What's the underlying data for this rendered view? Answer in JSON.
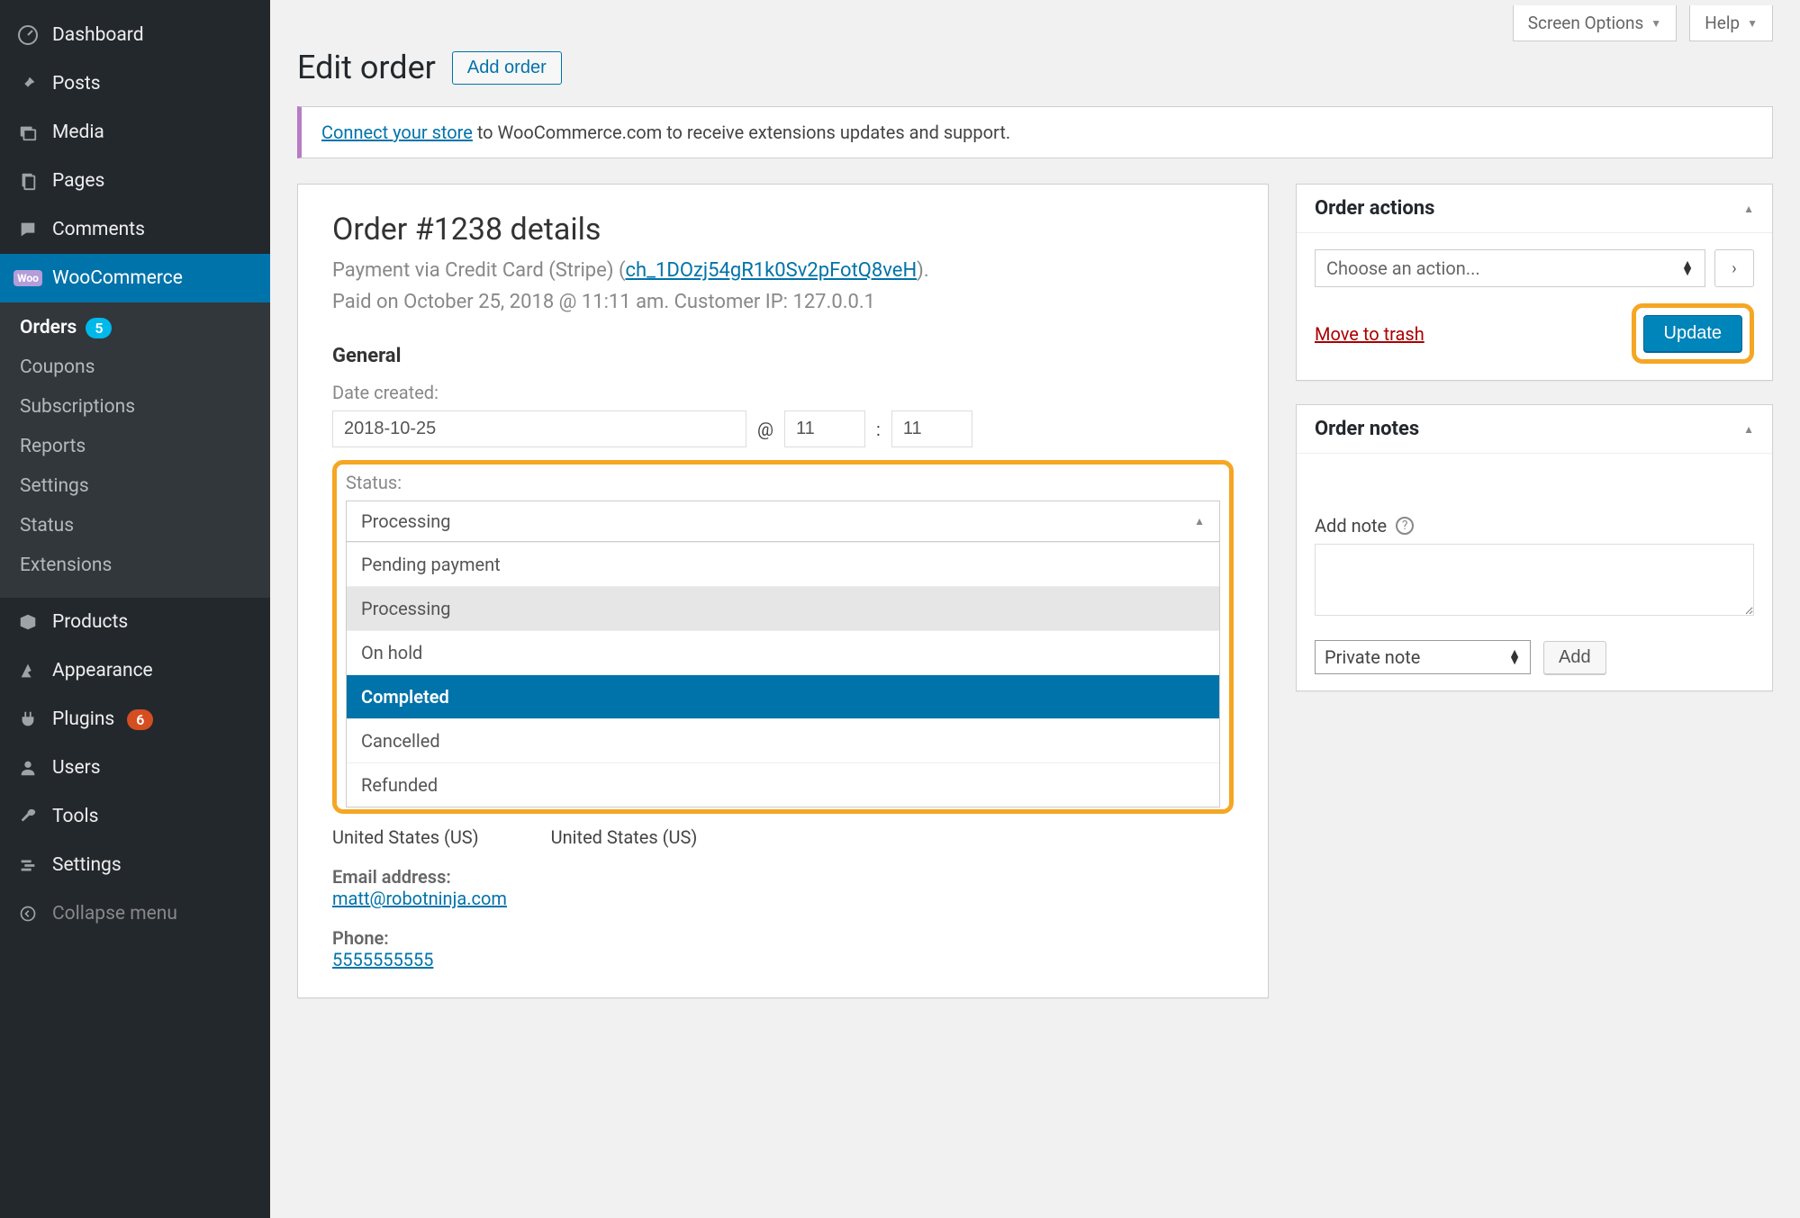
{
  "topTabs": {
    "screenOptions": "Screen Options",
    "help": "Help"
  },
  "sidebar": {
    "dashboard": "Dashboard",
    "posts": "Posts",
    "media": "Media",
    "pages": "Pages",
    "comments": "Comments",
    "woocommerce": "WooCommerce",
    "sub": {
      "orders": "Orders",
      "ordersCount": "5",
      "coupons": "Coupons",
      "subscriptions": "Subscriptions",
      "reports": "Reports",
      "settings": "Settings",
      "status": "Status",
      "extensions": "Extensions"
    },
    "products": "Products",
    "appearance": "Appearance",
    "plugins": "Plugins",
    "pluginsCount": "6",
    "users": "Users",
    "tools": "Tools",
    "settings": "Settings",
    "collapse": "Collapse menu"
  },
  "page": {
    "title": "Edit order",
    "addOrder": "Add order"
  },
  "notice": {
    "link": "Connect your store",
    "rest": " to WooCommerce.com to receive extensions updates and support."
  },
  "order": {
    "title": "Order #1238 details",
    "paymentPre": "Payment via Credit Card (Stripe) (",
    "paymentLink": "ch_1DOzj54gR1k0Sv2pFotQ8veH",
    "paymentPost": ").",
    "paidLine": "Paid on October 25, 2018 @ 11:11 am. Customer IP: 127.0.0.1",
    "general": "General",
    "dateCreatedLabel": "Date created:",
    "dateValue": "2018-10-25",
    "at": "@",
    "hour": "11",
    "colon": ":",
    "minute": "11",
    "statusLabel": "Status:",
    "statusSelected": "Processing",
    "statusOptions": {
      "pending": "Pending payment",
      "processing": "Processing",
      "onhold": "On hold",
      "completed": "Completed",
      "cancelled": "Cancelled",
      "refunded": "Refunded"
    },
    "below": {
      "countryA": "United States (US)",
      "countryB": "United States (US)",
      "emailLabel": "Email address:",
      "email": "matt@robotninja.com",
      "phoneLabel": "Phone:",
      "phone": "5555555555"
    }
  },
  "actions": {
    "title": "Order actions",
    "choose": "Choose an action...",
    "trash": "Move to trash",
    "update": "Update"
  },
  "notes": {
    "title": "Order notes",
    "addNote": "Add note",
    "privateNote": "Private note",
    "add": "Add"
  }
}
